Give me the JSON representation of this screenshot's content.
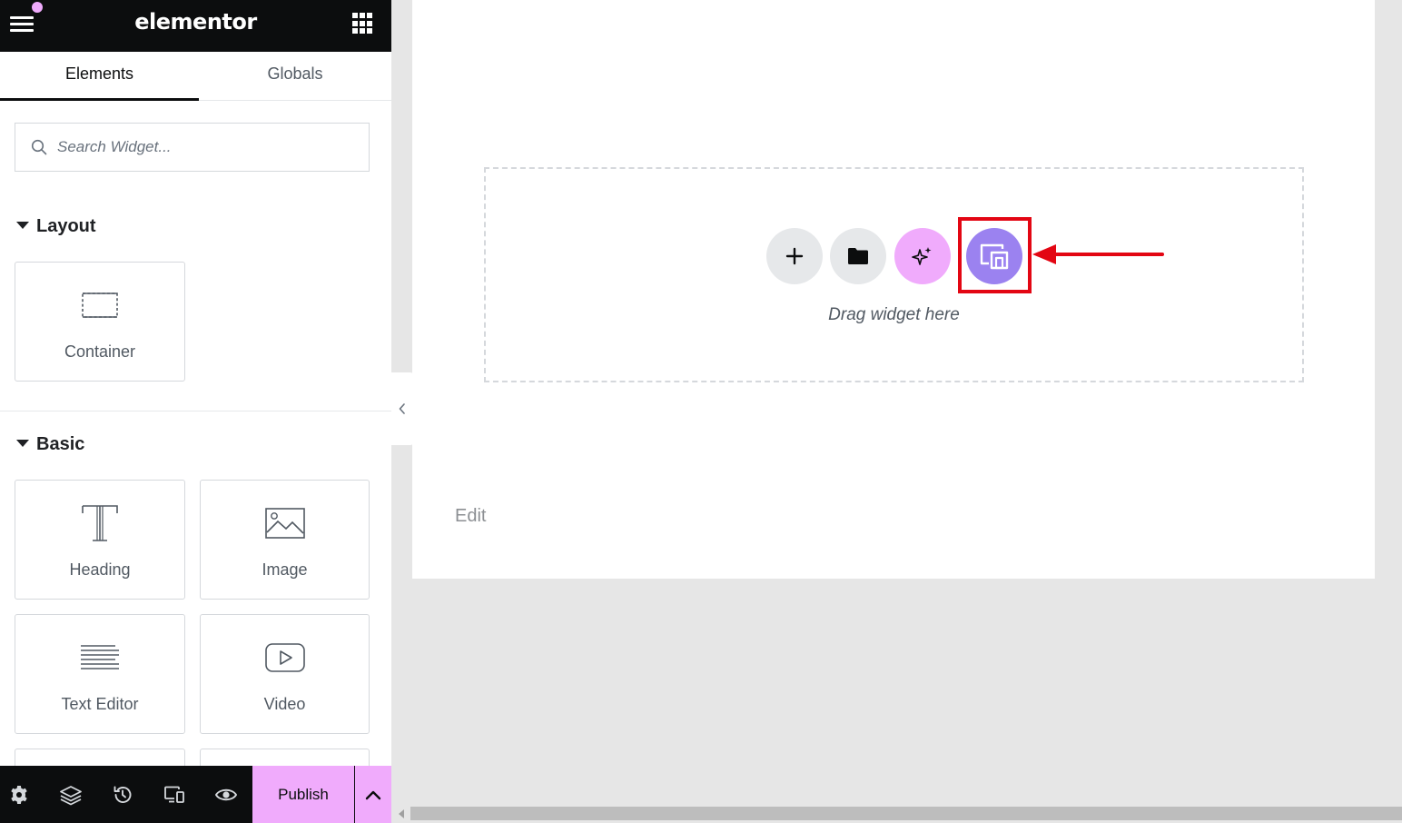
{
  "header": {
    "logo": "elementor",
    "menu_icon": "hamburger-icon",
    "apps_icon": "grid-icon",
    "notification_color": "#f0abfc"
  },
  "tabs": [
    {
      "label": "Elements",
      "active": true
    },
    {
      "label": "Globals",
      "active": false
    }
  ],
  "search": {
    "placeholder": "Search Widget..."
  },
  "sections": {
    "layout": {
      "title": "Layout",
      "widgets": [
        {
          "label": "Container",
          "icon": "container-icon"
        }
      ]
    },
    "basic": {
      "title": "Basic",
      "widgets": [
        {
          "label": "Heading",
          "icon": "heading-icon"
        },
        {
          "label": "Image",
          "icon": "image-icon"
        },
        {
          "label": "Text Editor",
          "icon": "text-editor-icon"
        },
        {
          "label": "Video",
          "icon": "video-icon"
        }
      ]
    }
  },
  "footer": {
    "icons": [
      "settings-icon",
      "layers-icon",
      "history-icon",
      "responsive-icon",
      "preview-icon"
    ],
    "publish_label": "Publish",
    "accent_color": "#f0abfc"
  },
  "canvas": {
    "dropzone_text": "Drag widget here",
    "buttons": [
      {
        "name": "add-section-button",
        "icon": "plus-icon"
      },
      {
        "name": "template-library-button",
        "icon": "folder-icon"
      },
      {
        "name": "ai-button",
        "icon": "sparkle-icon"
      },
      {
        "name": "responsive-templates-button",
        "icon": "devices-icon"
      }
    ],
    "edit_label": "Edit",
    "highlight_color": "#e30613"
  }
}
